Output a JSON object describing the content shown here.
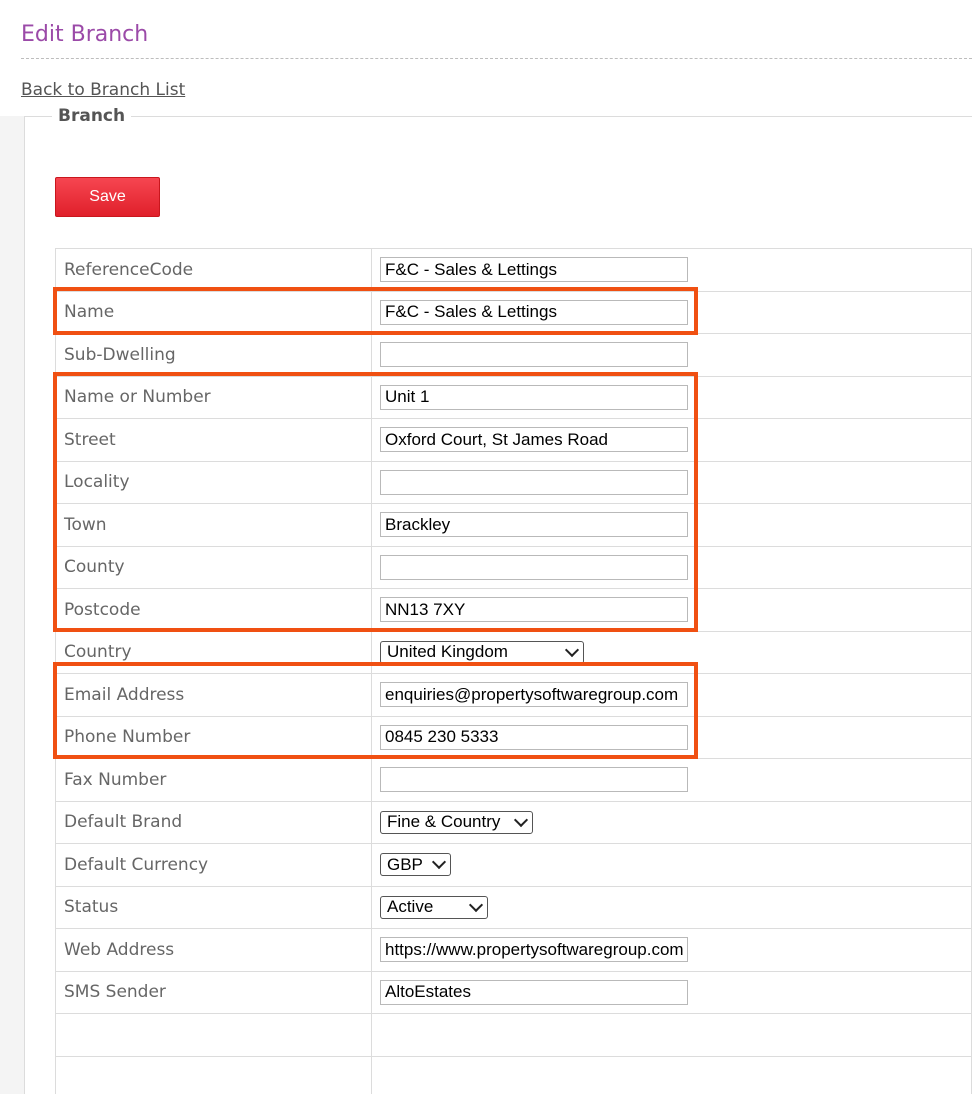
{
  "header": {
    "title": "Edit Branch",
    "back_link": "Back to Branch List"
  },
  "section": {
    "legend": "Branch"
  },
  "toolbar": {
    "save_label": "Save"
  },
  "fields": {
    "reference_code": {
      "label": "ReferenceCode",
      "value": "F&C - Sales & Lettings"
    },
    "name": {
      "label": "Name",
      "value": "F&C - Sales & Lettings"
    },
    "sub_dwelling": {
      "label": "Sub-Dwelling",
      "value": ""
    },
    "name_or_number": {
      "label": "Name or Number",
      "value": "Unit 1"
    },
    "street": {
      "label": "Street",
      "value": "Oxford Court, St James Road"
    },
    "locality": {
      "label": "Locality",
      "value": ""
    },
    "town": {
      "label": "Town",
      "value": "Brackley"
    },
    "county": {
      "label": "County",
      "value": ""
    },
    "postcode": {
      "label": "Postcode",
      "value": "NN13 7XY"
    },
    "country": {
      "label": "Country",
      "value": "United Kingdom"
    },
    "email": {
      "label": "Email Address",
      "value": "enquiries@propertysoftwaregroup.com"
    },
    "phone": {
      "label": "Phone Number",
      "value": "0845 230 5333"
    },
    "fax": {
      "label": "Fax Number",
      "value": ""
    },
    "default_brand": {
      "label": "Default Brand",
      "value": "Fine & Country"
    },
    "default_currency": {
      "label": "Default Currency",
      "value": "GBP"
    },
    "status": {
      "label": "Status",
      "value": "Active"
    },
    "web_address": {
      "label": "Web Address",
      "value": "https://www.propertysoftwaregroup.com"
    },
    "sms_sender": {
      "label": "SMS Sender",
      "value": "AltoEstates"
    }
  },
  "highlight_color": "#f05012"
}
